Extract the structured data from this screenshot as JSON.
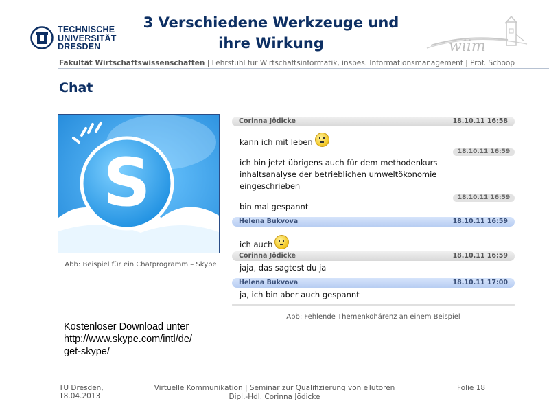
{
  "header": {
    "logo_lines": [
      "TECHNISCHE",
      "UNIVERSITÄT",
      "DRESDEN"
    ],
    "title_line1": "3 Verschiedene Werkzeuge und",
    "title_line2": "ihre Wirkung",
    "wiim_logo_text": "wiim",
    "faculty": "Fakultät Wirtschaftswissenschaften",
    "chair": "| Lehrstuhl für Wirtschaftsinformatik, insbes. Informationsmanagement | Prof. Schoop"
  },
  "section_title": "Chat",
  "skype_caption": "Abb: Beispiel für ein Chatprogramm – Skype",
  "chat": {
    "rows": [
      {
        "kind": "header",
        "style": "gray",
        "name": "Corinna Jödicke",
        "time": "18.10.11 16:58"
      },
      {
        "kind": "message",
        "text": "kann ich mit leben",
        "smiley": true
      },
      {
        "kind": "timestamp",
        "time": "18.10.11 16:59"
      },
      {
        "kind": "message",
        "text": "ich bin jetzt übrigens auch für dem methodenkurs"
      },
      {
        "kind": "message",
        "text": "inhaltsanalyse der betrieblichen umweltökonomie"
      },
      {
        "kind": "message",
        "text": "eingeschrieben"
      },
      {
        "kind": "timestamp",
        "time": "18.10.11 16:59"
      },
      {
        "kind": "message",
        "text": "bin mal gespannt"
      },
      {
        "kind": "header",
        "style": "blue",
        "name": "Helena Bukvova",
        "time": "18.10.11 16:59"
      },
      {
        "kind": "message",
        "text": "ich auch",
        "smiley": true
      },
      {
        "kind": "header",
        "style": "gray",
        "name": "Corinna Jödicke",
        "time": "18.10.11 16:59"
      },
      {
        "kind": "message",
        "text": "jaja, das sagtest du ja"
      },
      {
        "kind": "header",
        "style": "blue",
        "name": "Helena Bukvova",
        "time": "18.10.11 17:00"
      },
      {
        "kind": "message",
        "text": "ja, ich bin aber auch gespannt"
      }
    ],
    "caption": "Abb: Fehlende Themenkohärenz an einem Beispiel"
  },
  "download": {
    "line1": "Kostenloser Download unter",
    "line2": "http://www.skype.com/intl/de/",
    "line3": "get-skype/"
  },
  "footer": {
    "org": "TU Dresden,",
    "date": "18.04.2013",
    "center_line1": "Virtuelle Kommunikation | Seminar zur Qualifizierung von eTutoren",
    "center_line2": "Dipl.-Hdl. Corinna Jödicke",
    "slide": "Folie 18"
  },
  "colors": {
    "brand_blue": "#0d2f63",
    "skype_blue": "#2f9be6",
    "chat_gray": "#d8d8d8",
    "chat_blue": "#b7cdf2"
  }
}
